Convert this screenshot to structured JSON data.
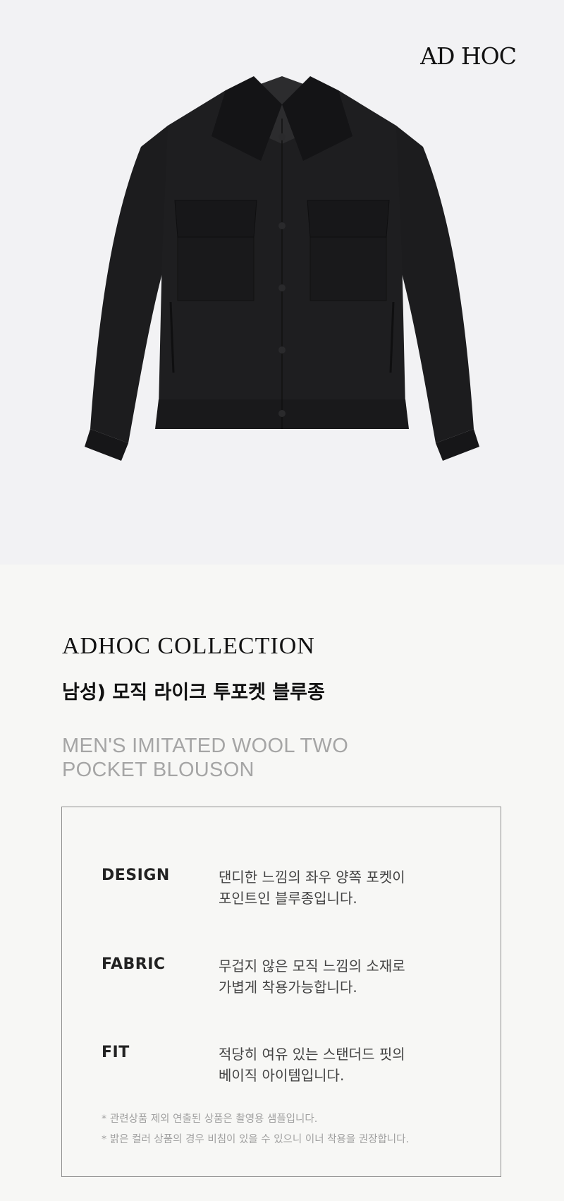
{
  "brand": {
    "logo_text": "AD HOC"
  },
  "hero": {
    "product_image": "black-two-pocket-blouson-jacket",
    "background": "#f2f2f4"
  },
  "product": {
    "collection_title": "ADHOC  COLLECTION",
    "name_ko": "남성) 모직 라이크 투포켓 블루종",
    "name_en_lines": [
      "MEN'S IMITATED WOOL TWO",
      "POCKET BLOUSON"
    ]
  },
  "specs": [
    {
      "label": "DESIGN",
      "lines": [
        "댄디한 느낌의 좌우 양쪽 포켓이",
        "포인트인 블루종입니다."
      ]
    },
    {
      "label": "FABRIC",
      "lines": [
        "무겁지 않은 모직 느낌의 소재로",
        "가볍게 착용가능합니다."
      ]
    },
    {
      "label": "FIT",
      "lines": [
        "적당히 여유 있는 스탠더드 핏의",
        "베이직 아이템입니다."
      ]
    }
  ],
  "notes": [
    "* 관련상품 제외 연출된 상품은 촬영용 샘플입니다.",
    "* 밝은 컬러 상품의 경우 비침이 있을 수 있으니 이너 착용을 권장합니다."
  ],
  "colors": {
    "page_background": "#f7f7f5",
    "jacket": "#1b1b1d",
    "text_primary": "#111111",
    "text_muted": "#a5a5a5",
    "box_border": "#8e8e8e"
  }
}
